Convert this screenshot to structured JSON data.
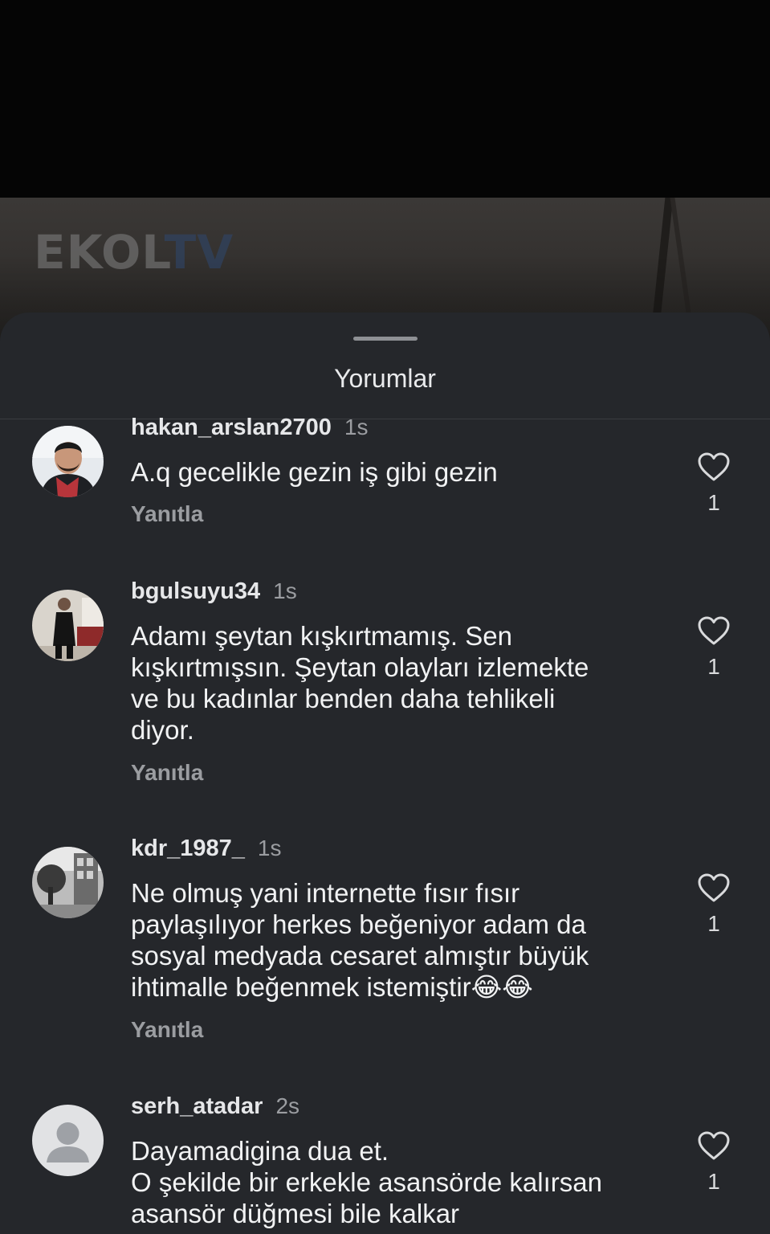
{
  "video": {
    "logo_left": "EKOL",
    "logo_right": "TV"
  },
  "sheet": {
    "title": "Yorumlar"
  },
  "comments": [
    {
      "username": "hakan_arslan2700",
      "time": "1s",
      "text": "A.q gecelikle gezin iş gibi gezin",
      "reply_label": "Yanıtla",
      "likes": "1",
      "avatar": "person-portrait"
    },
    {
      "username": "bgulsuyu34",
      "time": "1s",
      "text": "Adamı şeytan kışkırtmamış. Sen\nkışkırtmışsın. Şeytan olayları izlemekte\nve bu kadınlar benden daha tehlikeli\ndiyor.",
      "reply_label": "Yanıtla",
      "likes": "1",
      "avatar": "person-full-body"
    },
    {
      "username": "kdr_1987_",
      "time": "1s",
      "text": "Ne olmuş yani internette fısır fısır\npaylaşılıyor herkes beğeniyor adam da\nsosyal medyada cesaret almıştır büyük\nihtimalle beğenmek istemiştir😂😂",
      "reply_label": "Yanıtla",
      "likes": "1",
      "avatar": "street-photo-bw"
    },
    {
      "username": "serh_atadar",
      "time": "2s",
      "text": "Dayamadigina dua et.\nO şekilde bir erkekle asansörde kalırsan\nasansör düğmesi bile kalkar",
      "likes": "1",
      "avatar": "default-user"
    }
  ],
  "icons": {
    "like": "heart-outline-icon"
  },
  "colors": {
    "sheet_bg": "#25272b",
    "text_primary": "#f1f2f3",
    "text_secondary": "#9b9da1"
  }
}
